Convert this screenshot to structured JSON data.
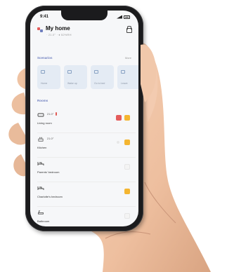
{
  "phone": {
    "status_time": "9:41",
    "home_title": "My home",
    "home_sub": "· 21.0° · ♦ 52%RH",
    "scenes_label": "Scenarios",
    "scenes_more": "More",
    "rooms_label": "Rooms",
    "scenes": [
      {
        "label": "Home"
      },
      {
        "label": "Wake up"
      },
      {
        "label": "Go to bed"
      },
      {
        "label": "Leave"
      }
    ],
    "rooms": [
      {
        "name": "Living room",
        "temp": "21.0°"
      },
      {
        "name": "Kitchen",
        "temp": "21.0°"
      },
      {
        "name": "Parents' bedroom",
        "temp": ""
      },
      {
        "name": "Charlotte's bedroom",
        "temp": ""
      },
      {
        "name": "Bathroom",
        "temp": ""
      }
    ]
  },
  "colors": {
    "accent": "#6f7fbf",
    "toggle_red": "#e45c5c",
    "toggle_yellow": "#f4b531",
    "scene_tile": "#e4ebf4",
    "phone_body": "#1b1b1d",
    "skin": "#efc4a5"
  }
}
